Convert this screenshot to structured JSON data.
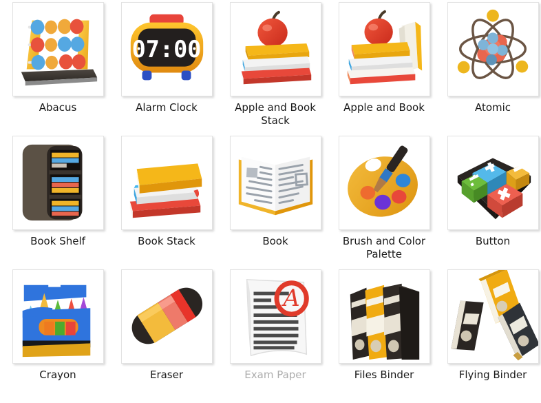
{
  "gallery": {
    "columns": 5,
    "rows": 3,
    "background_color": "#ffffff",
    "label_color": "#1a1a1a",
    "faded_label_color": "#8d8d8d",
    "items": [
      {
        "label": "Abacus",
        "icon": "abacus-icon",
        "faded": false
      },
      {
        "label": "Alarm Clock",
        "icon": "alarm-clock-icon",
        "faded": false,
        "display_value": "07:00"
      },
      {
        "label": "Apple and Book Stack",
        "icon": "apple-and-book-stack-icon",
        "faded": false
      },
      {
        "label": "Apple and Book",
        "icon": "apple-and-book-icon",
        "faded": false
      },
      {
        "label": "Atomic",
        "icon": "atomic-icon",
        "faded": false
      },
      {
        "label": "Book Shelf",
        "icon": "book-shelf-icon",
        "faded": false
      },
      {
        "label": "Book Stack",
        "icon": "book-stack-icon",
        "faded": false
      },
      {
        "label": "Book",
        "icon": "book-icon",
        "faded": false
      },
      {
        "label": "Brush and Color Palette",
        "icon": "brush-and-color-palette-icon",
        "faded": false
      },
      {
        "label": "Button",
        "icon": "button-icon",
        "faded": false,
        "key_symbols": [
          "+",
          "−",
          "÷",
          "×"
        ]
      },
      {
        "label": "Crayon",
        "icon": "crayon-icon",
        "faded": false
      },
      {
        "label": "Eraser",
        "icon": "eraser-icon",
        "faded": false
      },
      {
        "label": "Exam Paper",
        "icon": "exam-paper-icon",
        "faded": true,
        "grade_mark": "A"
      },
      {
        "label": "Files Binder",
        "icon": "files-binder-icon",
        "faded": false
      },
      {
        "label": "Flying Binder",
        "icon": "flying-binder-icon",
        "faded": false
      }
    ]
  }
}
